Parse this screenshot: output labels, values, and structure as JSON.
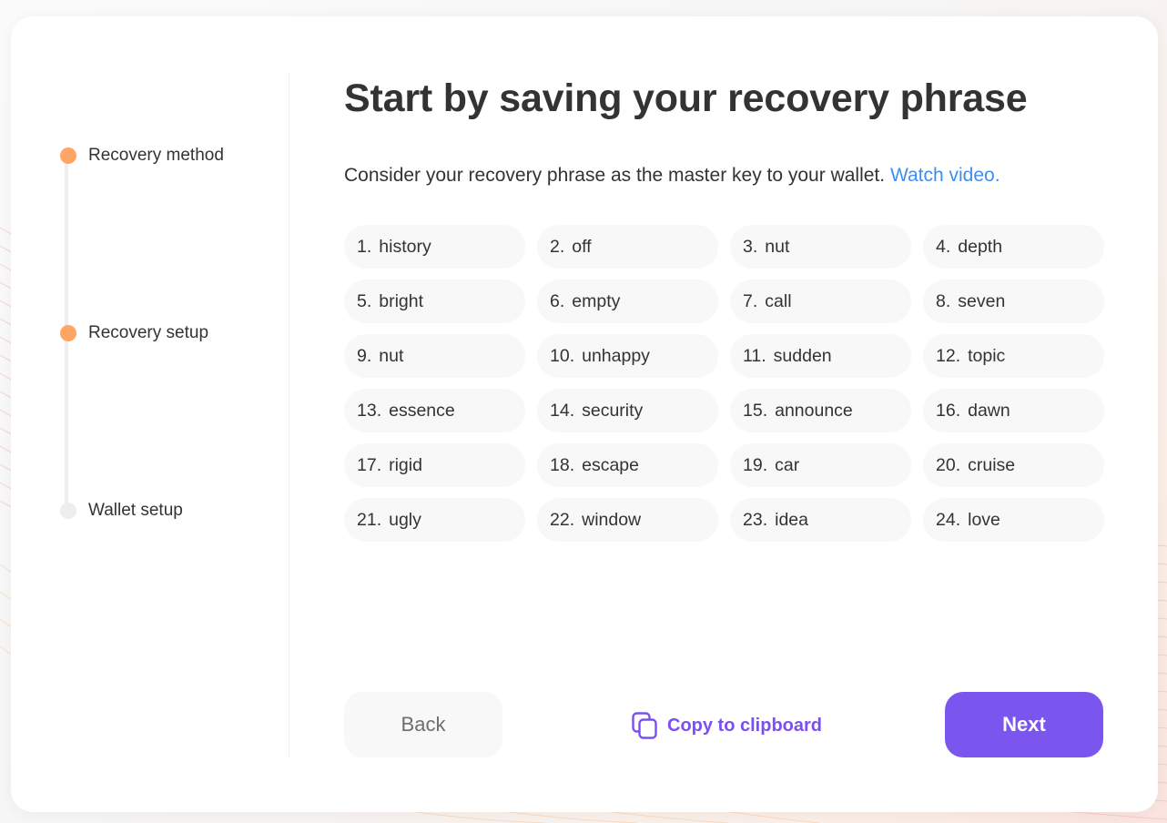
{
  "stepper": {
    "steps": [
      {
        "label": "Recovery method",
        "state": "complete"
      },
      {
        "label": "Recovery setup",
        "state": "active"
      },
      {
        "label": "Wallet setup",
        "state": "pending"
      }
    ],
    "active_color": "#ffa664",
    "inactive_color": "#eeeeee"
  },
  "main": {
    "title": "Start by saving your recovery phrase",
    "subtitle": "Consider your recovery phrase as the master key to your wallet.",
    "watch_video_link": "Watch video.",
    "words": [
      {
        "num": "1.",
        "word": "history"
      },
      {
        "num": "2.",
        "word": "off"
      },
      {
        "num": "3.",
        "word": "nut"
      },
      {
        "num": "4.",
        "word": "depth"
      },
      {
        "num": "5.",
        "word": "bright"
      },
      {
        "num": "6.",
        "word": "empty"
      },
      {
        "num": "7.",
        "word": "call"
      },
      {
        "num": "8.",
        "word": "seven"
      },
      {
        "num": "9.",
        "word": "nut"
      },
      {
        "num": "10.",
        "word": "unhappy"
      },
      {
        "num": "11.",
        "word": "sudden"
      },
      {
        "num": "12.",
        "word": "topic"
      },
      {
        "num": "13.",
        "word": "essence"
      },
      {
        "num": "14.",
        "word": "security"
      },
      {
        "num": "15.",
        "word": "announce"
      },
      {
        "num": "16.",
        "word": "dawn"
      },
      {
        "num": "17.",
        "word": "rigid"
      },
      {
        "num": "18.",
        "word": "escape"
      },
      {
        "num": "19.",
        "word": "car"
      },
      {
        "num": "20.",
        "word": "cruise"
      },
      {
        "num": "21.",
        "word": "ugly"
      },
      {
        "num": "22.",
        "word": "window"
      },
      {
        "num": "23.",
        "word": "idea"
      },
      {
        "num": "24.",
        "word": "love"
      }
    ]
  },
  "footer": {
    "back_label": "Back",
    "copy_label": "Copy to clipboard",
    "copy_icon": "copy-icon",
    "next_label": "Next"
  },
  "colors": {
    "accent": "#7b56ee",
    "link": "#3e8ef0",
    "pill_bg": "#f8f8f8"
  }
}
